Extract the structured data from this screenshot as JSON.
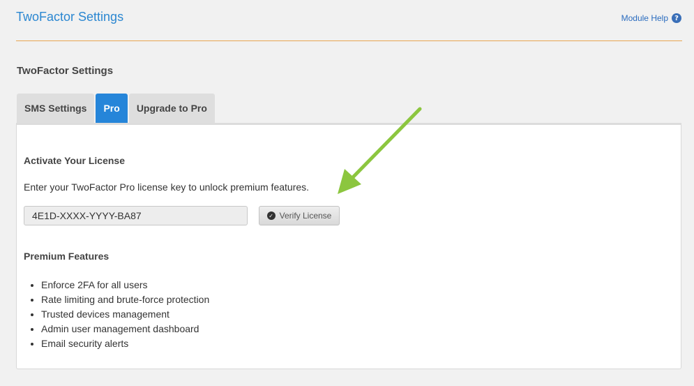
{
  "header": {
    "title": "TwoFactor Settings",
    "help_label": "Module Help",
    "help_icon": "question-icon"
  },
  "section": {
    "title": "TwoFactor Settings"
  },
  "tabs": [
    {
      "label": "SMS Settings",
      "active": false
    },
    {
      "label": "Pro",
      "active": true
    },
    {
      "label": "Upgrade to Pro",
      "active": false
    }
  ],
  "license": {
    "title": "Activate Your License",
    "description": "Enter your TwoFactor Pro license key to unlock premium features.",
    "input_value": "4E1D-XXXX-YYYY-BA87",
    "verify_label": "Verify License"
  },
  "premium": {
    "title": "Premium Features",
    "items": [
      "Enforce 2FA for all users",
      "Rate limiting and brute-force protection",
      "Trusted devices management",
      "Admin user management dashboard",
      "Email security alerts"
    ]
  },
  "colors": {
    "accent": "#2585d9",
    "divider": "#e8a552",
    "arrow": "#8cc63f"
  }
}
